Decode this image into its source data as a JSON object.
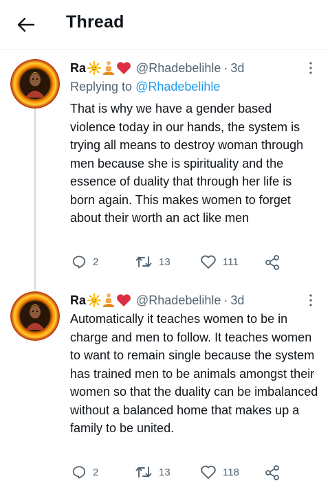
{
  "header": {
    "title": "Thread",
    "back_icon": "arrow-left-icon"
  },
  "tweets": [
    {
      "author_name": "Ra",
      "author_emojis": [
        "sun-emoji",
        "person-lotus-emoji",
        "red-heart-emoji"
      ],
      "handle": "@Rhadebelihle",
      "separator": "·",
      "time": "3d",
      "replying_prefix": "Replying to",
      "replying_to": "@Rhadebelihle",
      "text": "That is why we have a gender based violence today in our hands, the system is trying all means to destroy woman through men because she is spirituality and the essence of duality that through her life is born again. This makes women to forget about their worth an act like men",
      "replies": "2",
      "retweets": "13",
      "likes": "111"
    },
    {
      "author_name": "Ra",
      "author_emojis": [
        "sun-emoji",
        "person-lotus-emoji",
        "red-heart-emoji"
      ],
      "handle": "@Rhadebelihle",
      "separator": "·",
      "time": "3d",
      "text": "Automatically it teaches women to be in charge and men to follow. It teaches women to want to remain single because the system has trained men to be animals amongst their women so that the duality can be imbalanced without a balanced home that makes up a family to be united.",
      "replies": "2",
      "retweets": "13",
      "likes": "118"
    }
  ],
  "colors": {
    "text": "#0f1419",
    "secondary": "#536471",
    "link": "#1d9bf0",
    "thread_line": "#cfd9de"
  }
}
